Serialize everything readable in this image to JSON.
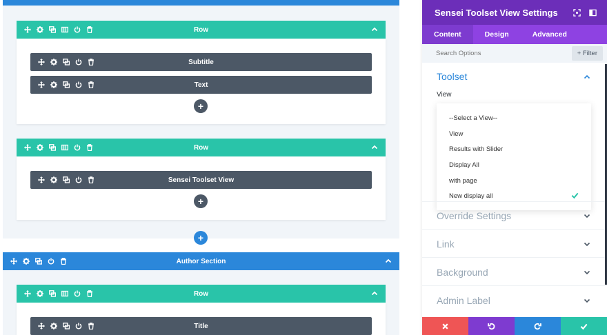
{
  "builder": {
    "row1": {
      "label": "Row",
      "modules": [
        {
          "label": "Subtitle"
        },
        {
          "label": "Text"
        }
      ]
    },
    "row2": {
      "label": "Row",
      "modules": [
        {
          "label": "Sensei Toolset View"
        }
      ]
    },
    "section2": {
      "label": "Author Section"
    },
    "row3": {
      "label": "Row",
      "modules": [
        {
          "label": "Title"
        }
      ]
    },
    "add_glyph": "+"
  },
  "panel": {
    "title": "Sensei Toolset View Settings",
    "tabs": [
      "Content",
      "Design",
      "Advanced"
    ],
    "active_tab": "Content",
    "search_placeholder": "Search Options",
    "filter_label": "+ Filter",
    "toolset_group": {
      "title": "Toolset",
      "field_label": "View",
      "options": [
        "--Select a View--",
        "View",
        "Results with Slider",
        "Display All",
        "with page",
        "New display all"
      ],
      "selected": "New display all"
    },
    "groups": [
      "Override Settings",
      "Link",
      "Background",
      "Admin Label"
    ]
  },
  "colors": {
    "section": "#2b87da",
    "row": "#29c4a9",
    "module": "#4c5866",
    "panel_header": "#6c2eb9",
    "panel_tabs": "#8e42e2",
    "discard": "#ef5555",
    "undo": "#7e3bd0",
    "redo": "#2b87da",
    "save": "#29c4a9",
    "check": "#29c4a9"
  }
}
